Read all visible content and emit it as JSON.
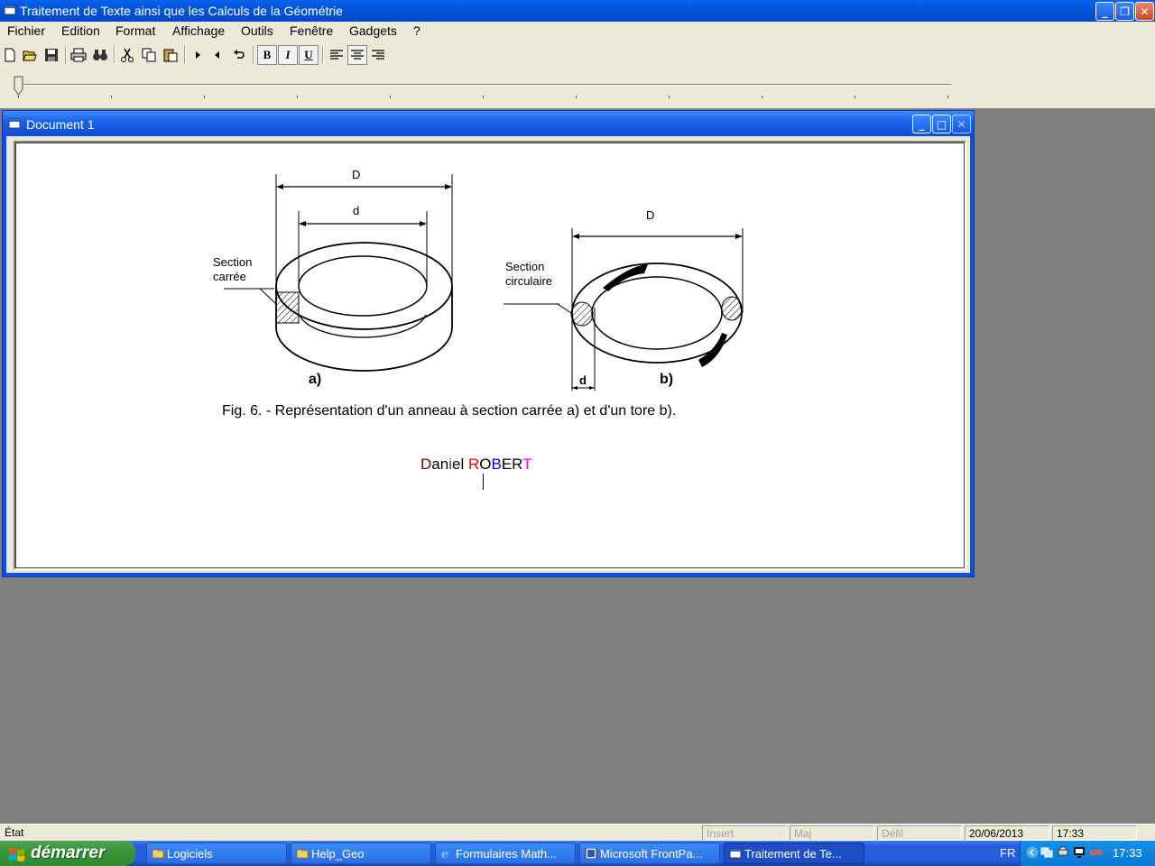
{
  "app": {
    "title": "Traitement de Texte ainsi que les Calculs de la Géométrie"
  },
  "menu": [
    "Fichier",
    "Edition",
    "Format",
    "Affichage",
    "Outils",
    "Fenêtre",
    "Gadgets",
    "?"
  ],
  "toolbar": {
    "bold_label": "B",
    "italic_label": "I",
    "underline_label": "U"
  },
  "document": {
    "title": "Document 1",
    "figure": {
      "label_D_a": "D",
      "label_d_a": "d",
      "section_a_line1": "Section",
      "section_a_line2": "carrée",
      "label_a": "a)",
      "label_D_b": "D",
      "section_b_line1": "Section",
      "section_b_line2": "circulaire",
      "label_d_b": "d",
      "label_b": "b)"
    },
    "caption": "Fig. 6. - Représentation d'un anneau à section carrée a) et d'un tore b).",
    "author": [
      {
        "text": "D",
        "color": "#800000"
      },
      {
        "text": "an",
        "color": "#000000"
      },
      {
        "text": "i",
        "color": "#008000"
      },
      {
        "text": "el ",
        "color": "#000000"
      },
      {
        "text": "R",
        "color": "#ff0000"
      },
      {
        "text": "O",
        "color": "#000000"
      },
      {
        "text": "B",
        "color": "#0000ff"
      },
      {
        "text": "E",
        "color": "#000000"
      },
      {
        "text": "R",
        "color": "#000000"
      },
      {
        "text": "T",
        "color": "#ff00ff"
      }
    ]
  },
  "statusbar": {
    "state": "État",
    "insert": "Insert",
    "caps": "Maj",
    "scroll": "Défil",
    "date": "20/06/2013",
    "time": "17:33"
  },
  "taskbar": {
    "start_label": "démarrer",
    "tasks": [
      {
        "label": "Logiciels"
      },
      {
        "label": "Help_Geo"
      },
      {
        "label": "Formulaires Math..."
      },
      {
        "label": "Microsoft FrontPa..."
      },
      {
        "label": "Traitement de Te..."
      }
    ],
    "language": "FR",
    "clock": "17:33"
  },
  "colors": {
    "titlebar": "#0254da",
    "window_face": "#ece9d8",
    "desktop": "#808080"
  }
}
